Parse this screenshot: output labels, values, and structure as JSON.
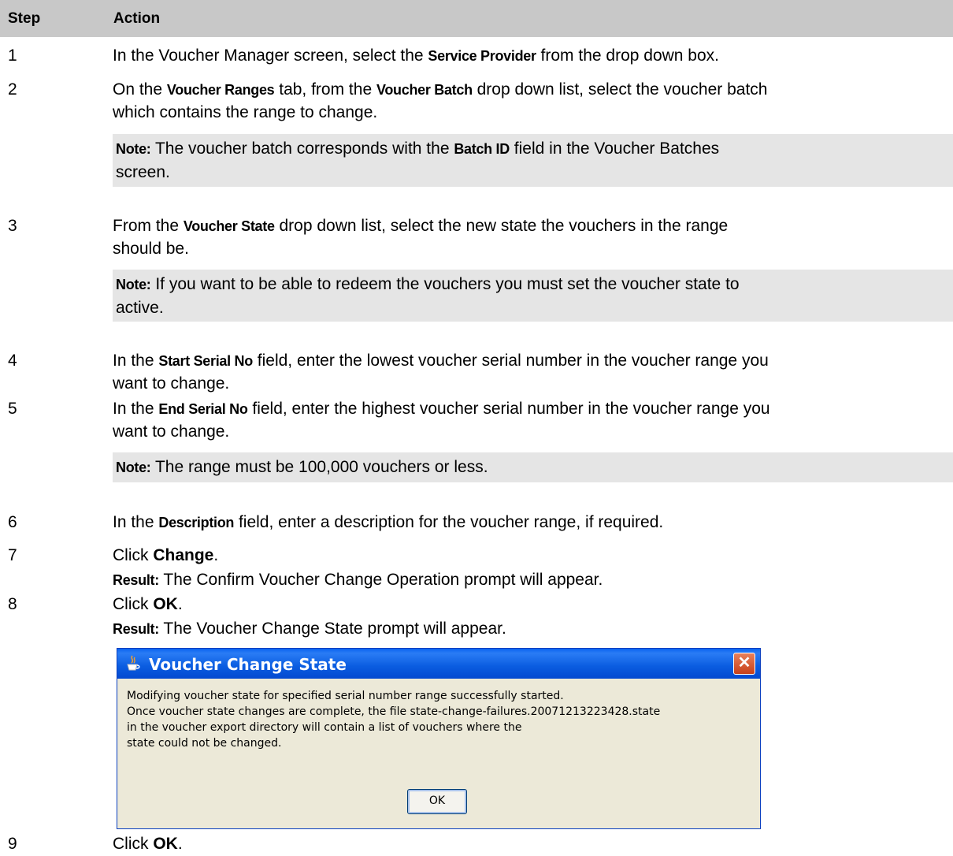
{
  "header": {
    "step": "Step",
    "action": "Action"
  },
  "steps": [
    {
      "n": "1",
      "parts": [
        "In the Voucher Manager screen, select the ",
        "Service Provider",
        " from the drop down box."
      ]
    },
    {
      "n": "2",
      "line1": [
        "On the ",
        "Voucher Ranges",
        " tab, from the ",
        "Voucher Batch",
        " drop down list, select the voucher batch"
      ],
      "line2": "which contains the range to change.",
      "note": {
        "label": "Note:",
        "line1": [
          " The voucher batch corresponds with the ",
          "Batch ID",
          " field in the Voucher Batches"
        ],
        "line2": "screen."
      }
    },
    {
      "n": "3",
      "line1": [
        "From the ",
        "Voucher State",
        " drop down list, select the new state the vouchers in the range"
      ],
      "line2": "should be.",
      "note": {
        "label": "Note:",
        "line1": " If you want to be able to redeem the vouchers you must set the voucher state to",
        "line2": "active."
      }
    },
    {
      "n": "4",
      "line1": [
        "In the ",
        "Start Serial No",
        " field, enter the lowest voucher serial number in the voucher range you"
      ],
      "line2": "want to change."
    },
    {
      "n": "5",
      "line1": [
        "In the ",
        "End Serial No",
        " field, enter the highest voucher serial number in the voucher range you"
      ],
      "line2": "want to change.",
      "note": {
        "label": "Note:",
        "text": " The range must be 100,000 vouchers or less."
      }
    },
    {
      "n": "6",
      "parts": [
        "In the ",
        "Description",
        " field, enter a description for the voucher range, if required."
      ]
    },
    {
      "n": "7",
      "parts": [
        "Click ",
        "Change",
        "."
      ],
      "result": {
        "label": "Result:",
        "text": " The Confirm Voucher Change Operation prompt will appear."
      }
    },
    {
      "n": "8",
      "parts": [
        "Click ",
        "OK",
        "."
      ],
      "result": {
        "label": "Result:",
        "text": " The Voucher Change State prompt will appear."
      }
    },
    {
      "n": "9",
      "parts": [
        "Click ",
        "OK",
        "."
      ]
    }
  ],
  "dialog": {
    "title": "Voucher Change State",
    "lines": [
      "Modifying voucher state for specified serial number range successfully started.",
      "Once voucher state changes are complete, the file state-change-failures.20071213223428.state",
      "in the voucher export directory will contain a list of vouchers where the",
      "state could not be changed."
    ],
    "ok_label": "OK"
  }
}
